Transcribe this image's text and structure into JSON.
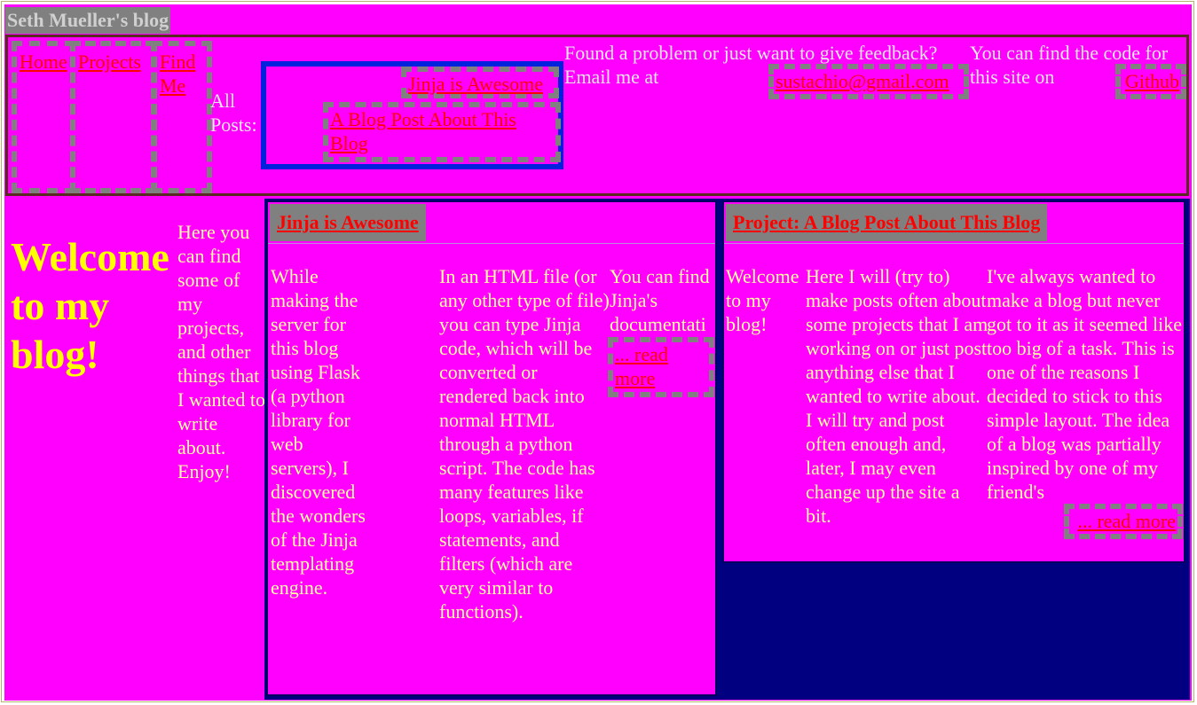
{
  "site": {
    "title": "Seth Mueller's blog"
  },
  "nav": {
    "home": "Home",
    "projects": "Projects",
    "find_me": "Find Me"
  },
  "all_posts": {
    "label": "All Posts:",
    "posts": [
      "Jinja is Awesome",
      "A Blog Post About This Blog"
    ]
  },
  "feedback": {
    "text": "Found a problem or just want to give feedback? Email me at",
    "email": "sustachio@gmail.com"
  },
  "code": {
    "text": "You can find the code for this site on",
    "link": "Github"
  },
  "main": {
    "welcome": "Welcome to my blog!",
    "intro": "Here you can find some of my projects, and other things that I wanted to write about. Enjoy!"
  },
  "cards": [
    {
      "title": "Jinja is Awesome",
      "columns": [
        "While making the server for this blog using Flask (a python library for web servers), I discovered the wonders of the Jinja templating engine.",
        "In an HTML file (or any other type of file) you can type Jinja code, which will be converted or rendered back into normal HTML through a python script. The code has many features like loops, variables, if statements, and filters (which are very similar to functions).",
        "You can find Jinja's documentati"
      ],
      "read_more": "... read more"
    },
    {
      "title": "Project: A Blog Post About This Blog",
      "columns": [
        "Welcome to my blog!",
        "Here I will (try to) make posts often about some projects that I am working on or just post anything else that I wanted to write about. I will try and post often enough and, later, I may even change up the site a bit.",
        "I've always wanted to make a blog but never got to it as it seemed like too big of a task. This is one of the reasons I decided to stick to this simple layout. The idea of a blog was partially inspired by one of my friend's"
      ],
      "read_more": "... read more"
    }
  ],
  "colors": {
    "page_bg": "#ff00ff",
    "link": "#ff0000",
    "heading": "#ffff00",
    "body_text": "#ffffa0",
    "posts_bg": "#000080",
    "dashed_border": "#808080",
    "all_posts_border": "#0022dd"
  }
}
